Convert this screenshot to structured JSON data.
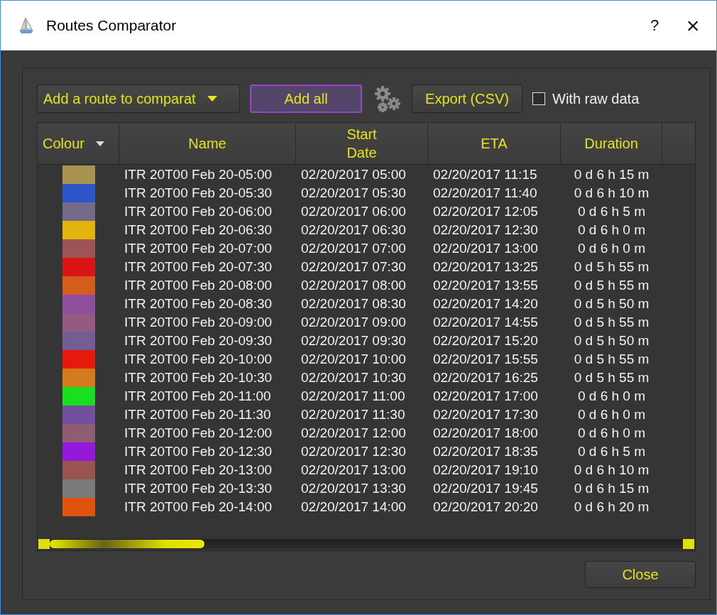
{
  "window": {
    "title": "Routes Comparator",
    "help": "?",
    "close": "×"
  },
  "toolbar": {
    "route_dropdown": "Add a route to comparat",
    "add_all": "Add all",
    "export": "Export (CSV)",
    "raw_data": {
      "label": "With raw data",
      "checked": false
    }
  },
  "table": {
    "columns": [
      "Colour",
      "Name",
      "Start\nDate",
      "ETA",
      "Duration"
    ],
    "rows": [
      {
        "color": "#a89450",
        "name": "ITR 20T00 Feb 20-05:00",
        "start": "02/20/2017 05:00",
        "eta": "02/20/2017 11:15",
        "duration": "0 d 6 h 15 m"
      },
      {
        "color": "#2c55c8",
        "name": "ITR 20T00 Feb 20-05:30",
        "start": "02/20/2017 05:30",
        "eta": "02/20/2017 11:40",
        "duration": "0 d 6 h 10 m"
      },
      {
        "color": "#756a88",
        "name": "ITR 20T00 Feb 20-06:00",
        "start": "02/20/2017 06:00",
        "eta": "02/20/2017 12:05",
        "duration": "0 d 6 h 5 m"
      },
      {
        "color": "#e2b40c",
        "name": "ITR 20T00 Feb 20-06:30",
        "start": "02/20/2017 06:30",
        "eta": "02/20/2017 12:30",
        "duration": "0 d 6 h 0 m"
      },
      {
        "color": "#9c5455",
        "name": "ITR 20T00 Feb 20-07:00",
        "start": "02/20/2017 07:00",
        "eta": "02/20/2017 13:00",
        "duration": "0 d 6 h 0 m"
      },
      {
        "color": "#da1414",
        "name": "ITR 20T00 Feb 20-07:30",
        "start": "02/20/2017 07:30",
        "eta": "02/20/2017 13:25",
        "duration": "0 d 5 h 55 m"
      },
      {
        "color": "#d45c1c",
        "name": "ITR 20T00 Feb 20-08:00",
        "start": "02/20/2017 08:00",
        "eta": "02/20/2017 13:55",
        "duration": "0 d 5 h 55 m"
      },
      {
        "color": "#8e4f9e",
        "name": "ITR 20T00 Feb 20-08:30",
        "start": "02/20/2017 08:30",
        "eta": "02/20/2017 14:20",
        "duration": "0 d 5 h 50 m"
      },
      {
        "color": "#955a82",
        "name": "ITR 20T00 Feb 20-09:00",
        "start": "02/20/2017 09:00",
        "eta": "02/20/2017 14:55",
        "duration": "0 d 5 h 55 m"
      },
      {
        "color": "#745c94",
        "name": "ITR 20T00 Feb 20-09:30",
        "start": "02/20/2017 09:30",
        "eta": "02/20/2017 15:20",
        "duration": "0 d 5 h 50 m"
      },
      {
        "color": "#e61a0c",
        "name": "ITR 20T00 Feb 20-10:00",
        "start": "02/20/2017 10:00",
        "eta": "02/20/2017 15:55",
        "duration": "0 d 5 h 55 m"
      },
      {
        "color": "#d57a1e",
        "name": "ITR 20T00 Feb 20-10:30",
        "start": "02/20/2017 10:30",
        "eta": "02/20/2017 16:25",
        "duration": "0 d 5 h 55 m"
      },
      {
        "color": "#18e020",
        "name": "ITR 20T00 Feb 20-11:00",
        "start": "02/20/2017 11:00",
        "eta": "02/20/2017 17:00",
        "duration": "0 d 6 h 0 m"
      },
      {
        "color": "#7150a0",
        "name": "ITR 20T00 Feb 20-11:30",
        "start": "02/20/2017 11:30",
        "eta": "02/20/2017 17:30",
        "duration": "0 d 6 h 0 m"
      },
      {
        "color": "#905c74",
        "name": "ITR 20T00 Feb 20-12:00",
        "start": "02/20/2017 12:00",
        "eta": "02/20/2017 18:00",
        "duration": "0 d 6 h 0 m"
      },
      {
        "color": "#9418dc",
        "name": "ITR 20T00 Feb 20-12:30",
        "start": "02/20/2017 12:30",
        "eta": "02/20/2017 18:35",
        "duration": "0 d 6 h 5 m"
      },
      {
        "color": "#9a5450",
        "name": "ITR 20T00 Feb 20-13:00",
        "start": "02/20/2017 13:00",
        "eta": "02/20/2017 19:10",
        "duration": "0 d 6 h 10 m"
      },
      {
        "color": "#7a7a7a",
        "name": "ITR 20T00 Feb 20-13:30",
        "start": "02/20/2017 13:30",
        "eta": "02/20/2017 19:45",
        "duration": "0 d 6 h 15 m"
      },
      {
        "color": "#e0520e",
        "name": "ITR 20T00 Feb 20-14:00",
        "start": "02/20/2017 14:00",
        "eta": "02/20/2017 20:20",
        "duration": "0 d 6 h 20 m"
      }
    ]
  },
  "footer": {
    "close": "Close"
  }
}
